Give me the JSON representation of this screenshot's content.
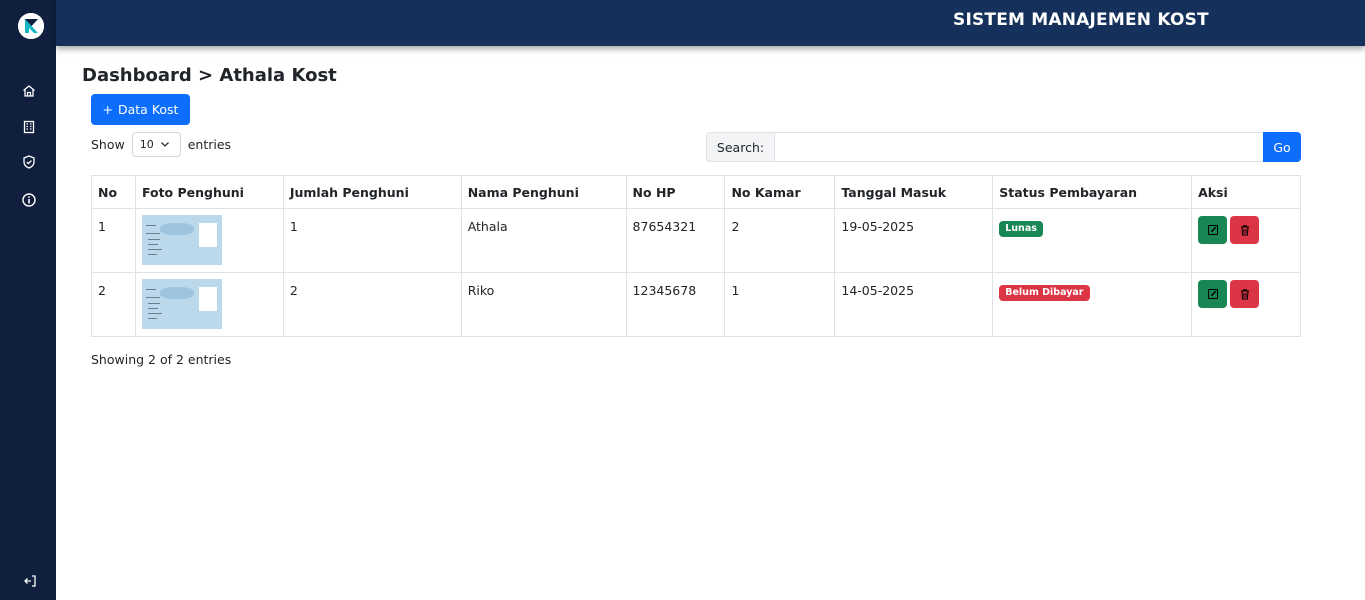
{
  "app": {
    "title": "SISTEM MANAJEMEN KOST"
  },
  "sidebar": {
    "items": [
      {
        "icon": "home-icon"
      },
      {
        "icon": "building-icon"
      },
      {
        "icon": "shield-check-icon"
      },
      {
        "icon": "info-icon"
      }
    ],
    "logout_icon": "logout-icon"
  },
  "breadcrumb": "Dashboard > Athala Kost",
  "toolbar": {
    "add_label": "Data Kost",
    "add_icon": "+"
  },
  "length": {
    "show_label": "Show",
    "value": "10",
    "entries_label": "entries"
  },
  "search": {
    "label": "Search:",
    "value": "",
    "go_label": "Go"
  },
  "table": {
    "headers": [
      "No",
      "Foto Penghuni",
      "Jumlah Penghuni",
      "Nama Penghuni",
      "No HP",
      "No Kamar",
      "Tanggal Masuk",
      "Status Pembayaran",
      "Aksi"
    ],
    "rows": [
      {
        "no": "1",
        "jumlah": "1",
        "nama": "Athala",
        "hp": "87654321",
        "kamar": "2",
        "tanggal": "19-05-2025",
        "status": "Lunas",
        "status_color": "#198754"
      },
      {
        "no": "2",
        "jumlah": "2",
        "nama": "Riko",
        "hp": "12345678",
        "kamar": "1",
        "tanggal": "14-05-2025",
        "status": "Belum Dibayar",
        "status_color": "#dc3545"
      }
    ]
  },
  "info": "Showing 2 of 2 entries",
  "colors": {
    "sidebar": "#0f1f3d",
    "topbar": "#15305a",
    "primary": "#0d6efd",
    "success": "#198754",
    "danger": "#dc3545"
  }
}
